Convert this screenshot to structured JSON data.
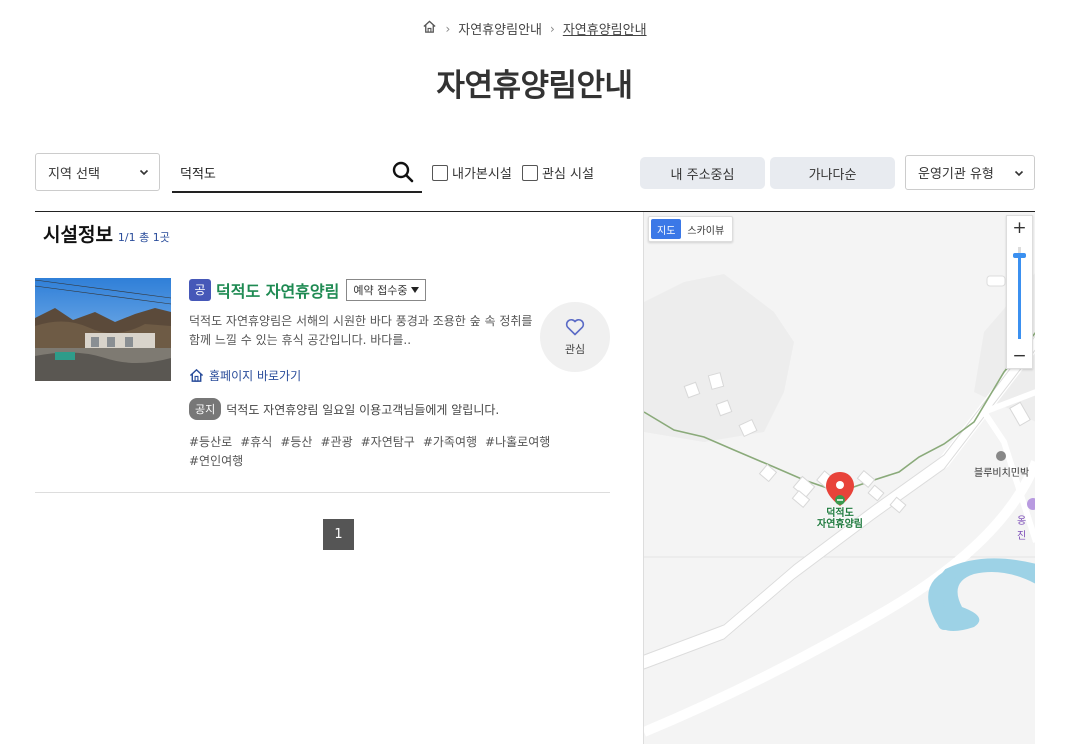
{
  "breadcrumb": {
    "items": [
      "자연휴양림안내",
      "자연휴양림안내"
    ],
    "sep": "›"
  },
  "page": {
    "title": "자연휴양림안내"
  },
  "filters": {
    "region_select": "지역 선택",
    "search_value": "덕적도",
    "check_visited": "내가본시설",
    "check_favorite": "관심 시설",
    "sort_near": "내 주소중심",
    "sort_alpha": "가나다순",
    "operator_select": "운영기관 유형"
  },
  "list": {
    "title": "시설정보",
    "count_text": "1/1 총 1곳",
    "items": [
      {
        "badge": "공",
        "name": "덕적도 자연휴양림",
        "status": "예약 접수중",
        "description": "덕적도 자연휴양림은 서해의 시원한 바다 풍경과 조용한 숲 속 정취를 함께 느낄 수 있는 휴식 공간입니다. 바다를..",
        "homepage": "홈페이지 바로가기",
        "notice_badge": "공지",
        "notice_text": "덕적도 자연휴양림 일요일 이용고객님들에게 알립니다.",
        "tags": [
          "#등산로",
          "#휴식",
          "#등산",
          "#관광",
          "#자연탐구",
          "#가족여행",
          "#나홀로여행",
          "#연인여행"
        ],
        "like_label": "관심"
      }
    ]
  },
  "pagination": {
    "current": "1"
  },
  "map": {
    "type_map": "지도",
    "type_sky": "스카이뷰",
    "zoom_in": "+",
    "zoom_out": "−",
    "marker_label_1": "덕적도",
    "marker_label_2": "자연휴양림",
    "poi_1": "블루비치민박",
    "poi_2": "옹진"
  },
  "colors": {
    "accent_green": "#1e8a52",
    "badge_blue": "#4658b8",
    "link_blue": "#2a4d9b",
    "marker_red": "#e8433a"
  }
}
